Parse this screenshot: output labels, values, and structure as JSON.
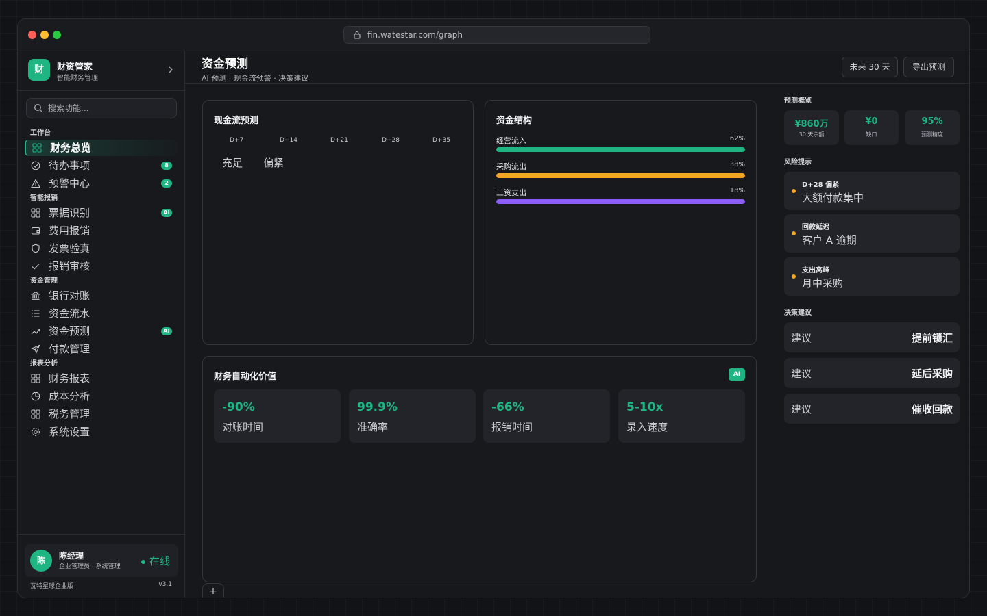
{
  "browser": {
    "url": "fin.watestar.com/graph"
  },
  "brand": {
    "logo": "财",
    "name": "财资管家",
    "subtitle": "智能财务管理"
  },
  "search": {
    "placeholder": "搜索功能..."
  },
  "sidebar": {
    "sections": [
      {
        "label": "工作台",
        "items": [
          {
            "label": "财务总览",
            "icon": "grid-icon",
            "active": true
          },
          {
            "label": "待办事项",
            "icon": "check-circle-icon",
            "badge": "8"
          },
          {
            "label": "预警中心",
            "icon": "warning-icon",
            "badge": "2"
          }
        ]
      },
      {
        "label": "智能报销",
        "items": [
          {
            "label": "票据识别",
            "icon": "grid-icon",
            "badge": "AI"
          },
          {
            "label": "费用报销",
            "icon": "wallet-icon"
          },
          {
            "label": "发票验真",
            "icon": "shield-icon"
          },
          {
            "label": "报销审核",
            "icon": "check-icon"
          }
        ]
      },
      {
        "label": "资金管理",
        "items": [
          {
            "label": "银行对账",
            "icon": "bank-icon"
          },
          {
            "label": "资金流水",
            "icon": "list-icon"
          },
          {
            "label": "资金预测",
            "icon": "trend-icon",
            "badge": "AI"
          },
          {
            "label": "付款管理",
            "icon": "send-icon"
          }
        ]
      },
      {
        "label": "报表分析",
        "items": [
          {
            "label": "财务报表",
            "icon": "grid-icon"
          },
          {
            "label": "成本分析",
            "icon": "pie-icon"
          },
          {
            "label": "税务管理",
            "icon": "grid-icon"
          },
          {
            "label": "系统设置",
            "icon": "gear-icon"
          }
        ]
      }
    ]
  },
  "user": {
    "avatar": "陈",
    "name": "陈经理",
    "role": "企业管理员 · 系统管理",
    "status": "在线"
  },
  "footer": {
    "edition": "瓦特星球企业版",
    "version": "v3.1"
  },
  "header": {
    "title": "资金预测",
    "subtitle": "AI 预测 · 现金流预警 · 决策建议",
    "range_button": "未来 30 天",
    "export_button": "导出预测"
  },
  "cashflow": {
    "title": "现金流预测",
    "ticks": [
      "D+7",
      "D+14",
      "D+21",
      "D+28",
      "D+35"
    ],
    "legend": [
      "充足",
      "偏紧"
    ]
  },
  "structure": {
    "title": "资金结构",
    "bars": [
      {
        "label": "经营流入",
        "pct_label": "62%",
        "value": 100,
        "color": "#1fb582"
      },
      {
        "label": "采购流出",
        "pct_label": "38%",
        "value": 100,
        "color": "#f5a524"
      },
      {
        "label": "工资支出",
        "pct_label": "18%",
        "value": 100,
        "color": "#8b5cf6"
      }
    ]
  },
  "automation": {
    "title": "财务自动化价值",
    "tag": "AI",
    "metrics": [
      {
        "value": "-90%",
        "label": "对账时间"
      },
      {
        "value": "99.9%",
        "label": "准确率"
      },
      {
        "value": "-66%",
        "label": "报销时间"
      },
      {
        "value": "5-10x",
        "label": "录入速度"
      }
    ]
  },
  "overview": {
    "label": "预测概览",
    "kpis": [
      {
        "value": "¥860万",
        "label": "30 天余额"
      },
      {
        "value": "¥0",
        "label": "缺口"
      },
      {
        "value": "95%",
        "label": "预测精度"
      }
    ]
  },
  "risks": {
    "label": "风险提示",
    "items": [
      {
        "title": "D+28 偏紧",
        "text": "大额付款集中"
      },
      {
        "title": "回款延迟",
        "text": "客户 A 逾期"
      },
      {
        "title": "支出高峰",
        "text": "月中采购"
      }
    ]
  },
  "suggestions": {
    "label": "决策建议",
    "items": [
      {
        "prefix": "建议",
        "action": "提前锁汇"
      },
      {
        "prefix": "建议",
        "action": "延后采购"
      },
      {
        "prefix": "建议",
        "action": "催收回款"
      }
    ]
  },
  "add_tab": "+"
}
